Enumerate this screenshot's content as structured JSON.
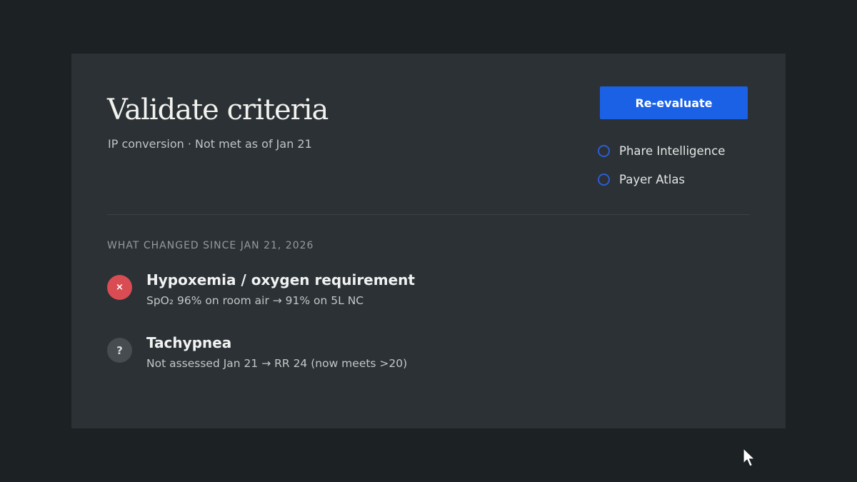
{
  "header": {
    "title": "Validate criteria",
    "subtitle": "IP conversion · Not met as of Jan 21"
  },
  "actions": {
    "reevaluate_label": "Re-evaluate"
  },
  "sources": [
    {
      "label": "Phare Intelligence",
      "selected": false
    },
    {
      "label": "Payer Atlas",
      "selected": false
    }
  ],
  "changes": {
    "heading": "WHAT CHANGED SINCE JAN 21, 2026",
    "items": [
      {
        "status": "not-met",
        "icon_glyph": "×",
        "title": "Hypoxemia / oxygen requirement",
        "detail": "SpO₂  96% on room air → 91% on 5L NC"
      },
      {
        "status": "unknown",
        "icon_glyph": "?",
        "title": "Tachypnea",
        "detail": "Not assessed Jan 21 → RR  24 (now meets >20)"
      }
    ]
  },
  "colors": {
    "background": "#1c2124",
    "card": "#2b3134",
    "accent": "#1b61e6",
    "fail": "#d94c53",
    "unknown": "#464c4f"
  }
}
